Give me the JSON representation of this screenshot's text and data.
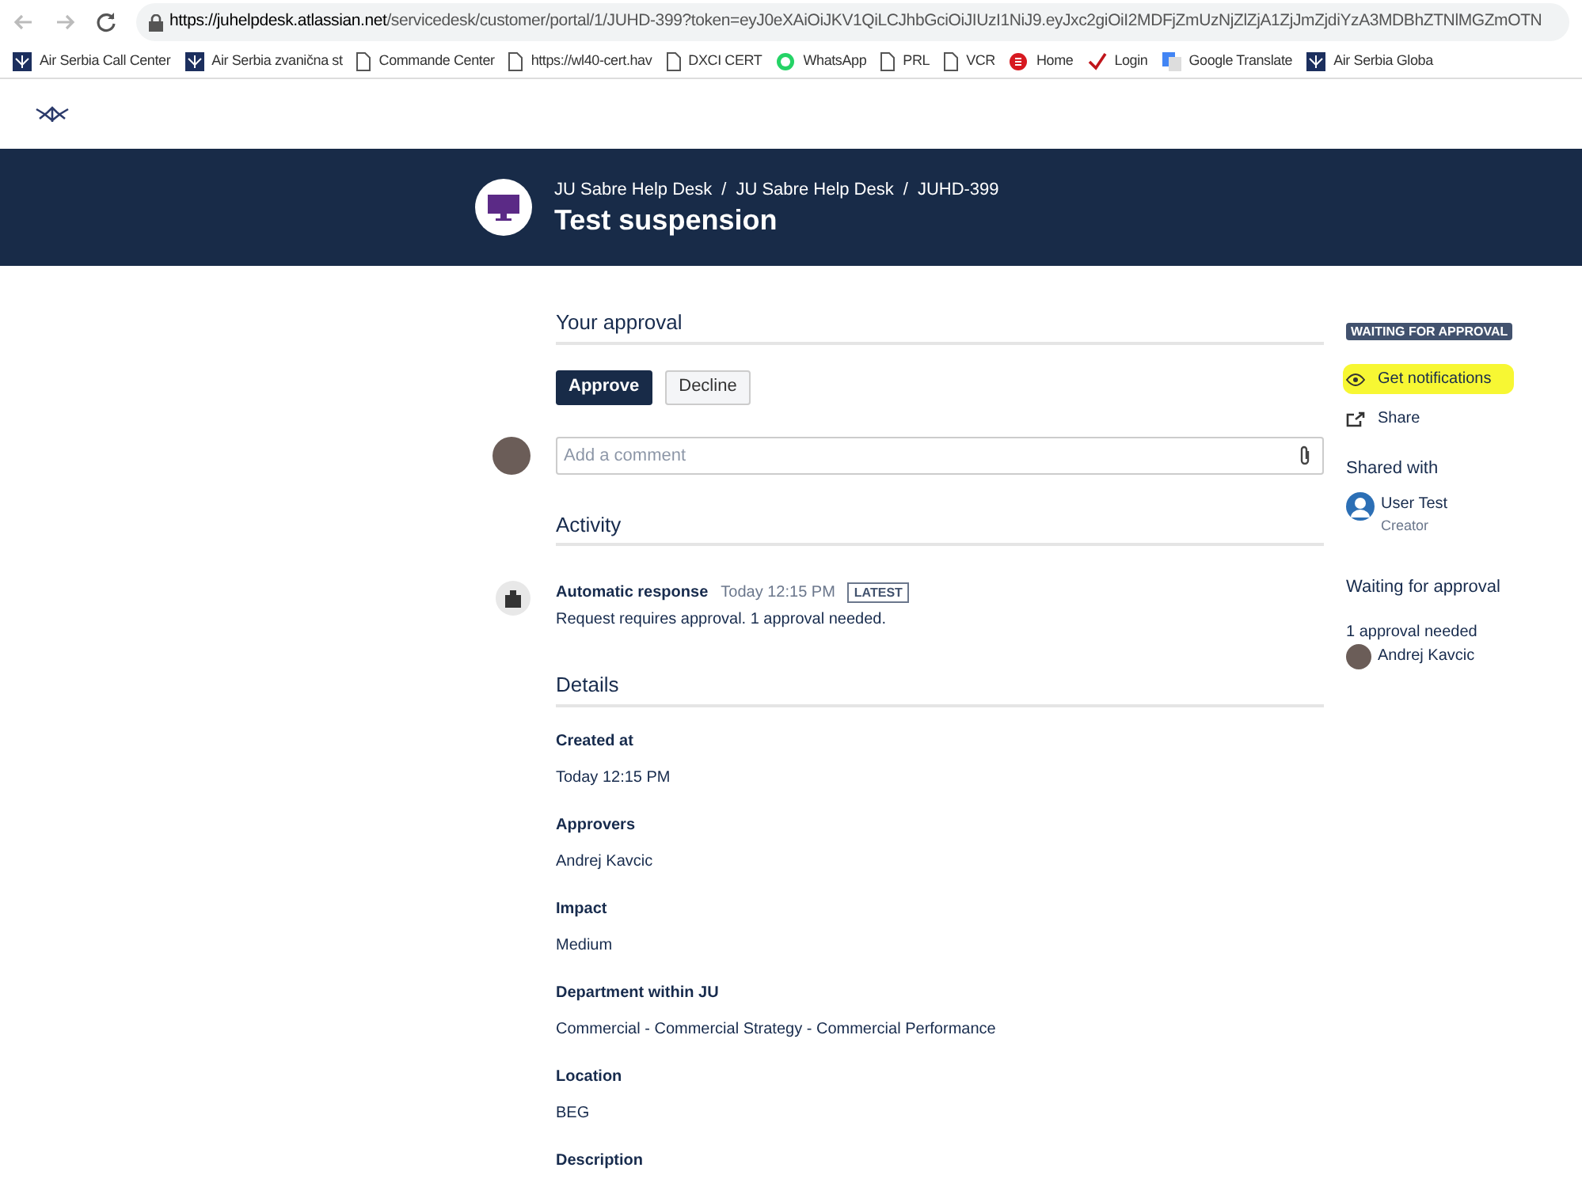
{
  "browser": {
    "url_host": "https://juhelpdesk.atlassian.net",
    "url_path": "/servicedesk/customer/portal/1/JUHD-399?token=eyJ0eXAiOiJKV1QiLCJhbGciOiJIUzI1NiJ9.eyJxc2giOiI2MDFjZmUzNjZlZjA1ZjJmZjdiYzA3MDBhZTNlMGZmOTN"
  },
  "bookmarks": [
    {
      "label": "Air Serbia Call Center",
      "kind": "logo"
    },
    {
      "label": "Air Serbia zvanična st",
      "kind": "logo"
    },
    {
      "label": "Commande Center",
      "kind": "page"
    },
    {
      "label": "https://wl40-cert.hav",
      "kind": "page"
    },
    {
      "label": "DXCI CERT",
      "kind": "page"
    },
    {
      "label": "WhatsApp",
      "kind": "whatsapp"
    },
    {
      "label": "PRL",
      "kind": "page"
    },
    {
      "label": "VCR",
      "kind": "page"
    },
    {
      "label": "Home",
      "kind": "red"
    },
    {
      "label": "Login",
      "kind": "check"
    },
    {
      "label": "Google Translate",
      "kind": "translate"
    },
    {
      "label": "Air Serbia Globa",
      "kind": "logo"
    }
  ],
  "header": {
    "breadcrumbs": [
      "JU Sabre Help Desk",
      "JU Sabre Help Desk",
      "JUHD-399"
    ],
    "separator": "/",
    "title": "Test suspension"
  },
  "approval": {
    "heading": "Your approval",
    "buttons": [
      {
        "label": "Approve",
        "primary": true
      },
      {
        "label": "Decline",
        "primary": false
      }
    ]
  },
  "comment": {
    "placeholder": "Add a comment"
  },
  "activity": {
    "heading": "Activity",
    "items": [
      {
        "author": "Automatic response",
        "time": "Today 12:15 PM",
        "badge": "LATEST",
        "text": "Request requires approval. 1 approval needed."
      }
    ]
  },
  "details": {
    "heading": "Details",
    "fields": [
      {
        "label": "Created at",
        "value": "Today 12:15 PM"
      },
      {
        "label": "Approvers",
        "value": "Andrej Kavcic"
      },
      {
        "label": "Impact",
        "value": "Medium"
      },
      {
        "label": "Department within JU",
        "value": "Commercial - Commercial Strategy - Commercial Performance"
      },
      {
        "label": "Location",
        "value": "BEG"
      },
      {
        "label": "Description"
      }
    ]
  },
  "sidebar": {
    "status": "WAITING FOR APPROVAL",
    "actions": [
      {
        "label": "Get notifications",
        "kind": "eye",
        "highlighted": true
      },
      {
        "label": "Share",
        "kind": "share",
        "highlighted": false
      }
    ],
    "shared_heading": "Shared with",
    "shared": [
      {
        "name": "User Test",
        "role": "Creator"
      }
    ],
    "waiting_heading": "Waiting for approval",
    "waiting_note": "1 approval needed",
    "approvers": [
      "Andrej Kavcic"
    ]
  }
}
